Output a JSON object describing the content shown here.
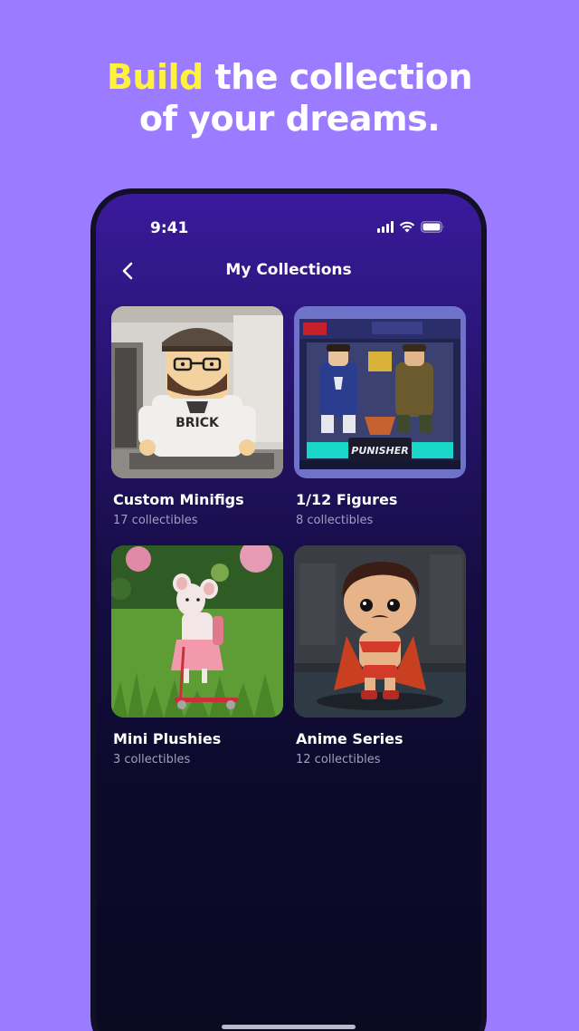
{
  "marketing": {
    "headline_highlight": "Build",
    "headline_rest_line1": " the collection",
    "headline_line2": "of your dreams."
  },
  "status_bar": {
    "time": "9:41"
  },
  "header": {
    "title": "My Collections",
    "back_icon": "chevron-left-icon"
  },
  "collections": [
    {
      "title": "Custom Minifigs",
      "count": "17 collectibles",
      "image": "lego-minifig-photo"
    },
    {
      "title": "1/12 Figures",
      "count": "8 collectibles",
      "image": "boxed-action-figures-photo"
    },
    {
      "title": "Mini Plushies",
      "count": "3 collectibles",
      "image": "mouse-plush-on-grass-photo"
    },
    {
      "title": "Anime Series",
      "count": "12 collectibles",
      "image": "vinyl-figure-caped-photo"
    }
  ],
  "colors": {
    "background": "#9b7bff",
    "highlight": "#fff23a",
    "screen_top": "#3a1a9c",
    "screen_bottom": "#0a0a22"
  }
}
